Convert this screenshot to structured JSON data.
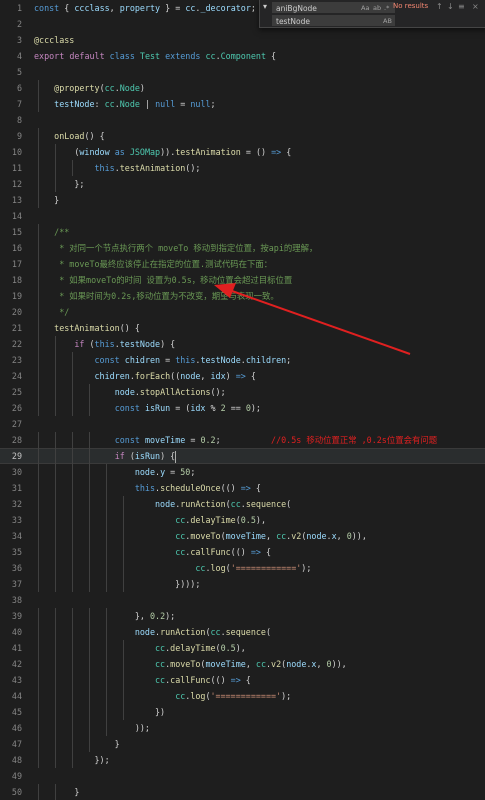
{
  "find": {
    "find_value": "aniBgNode",
    "replace_value": "testNode",
    "results_label": "No results",
    "match_case_label": "Aa",
    "whole_word_label": "ab",
    "regex_label": ".*",
    "preserve_case_label": "AB",
    "prev_icon": "arrow-up-icon",
    "next_icon": "arrow-down-icon",
    "toggle_icon": "chevron-down-icon"
  },
  "editor": {
    "active_line": 29,
    "annotation_text": "//0.5s 移动位置正常 ,0.2s位置会有问题",
    "arrow_color": "#e02020",
    "lines": [
      {
        "n": 1,
        "tokens": [
          [
            "kw",
            "const"
          ],
          [
            "pun",
            " { "
          ],
          [
            "var",
            "ccclass"
          ],
          [
            "pun",
            ", "
          ],
          [
            "var",
            "property"
          ],
          [
            "pun",
            " } = "
          ],
          [
            "var",
            "cc"
          ],
          [
            "pun",
            "."
          ],
          [
            "var",
            "_decorator"
          ],
          [
            "pun",
            ";"
          ]
        ]
      },
      {
        "n": 2,
        "tokens": []
      },
      {
        "n": 3,
        "tokens": [
          [
            "dec",
            "@ccclass"
          ]
        ]
      },
      {
        "n": 4,
        "tokens": [
          [
            "ctl",
            "export"
          ],
          [
            "pun",
            " "
          ],
          [
            "ctl",
            "default"
          ],
          [
            "pun",
            " "
          ],
          [
            "kw",
            "class"
          ],
          [
            "pun",
            " "
          ],
          [
            "cls",
            "Test"
          ],
          [
            "pun",
            " "
          ],
          [
            "kw",
            "extends"
          ],
          [
            "pun",
            " "
          ],
          [
            "cls",
            "cc"
          ],
          [
            "pun",
            "."
          ],
          [
            "cls",
            "Component"
          ],
          [
            "pun",
            " {"
          ]
        ]
      },
      {
        "n": 5,
        "tokens": []
      },
      {
        "n": 6,
        "tokens": [
          [
            "pun",
            "    "
          ],
          [
            "dec",
            "@property"
          ],
          [
            "pun",
            "("
          ],
          [
            "cls",
            "cc"
          ],
          [
            "pun",
            "."
          ],
          [
            "cls",
            "Node"
          ],
          [
            "pun",
            ")"
          ]
        ]
      },
      {
        "n": 7,
        "tokens": [
          [
            "pun",
            "    "
          ],
          [
            "var",
            "testNode"
          ],
          [
            "pun",
            ": "
          ],
          [
            "cls",
            "cc"
          ],
          [
            "pun",
            "."
          ],
          [
            "cls",
            "Node"
          ],
          [
            "pun",
            " | "
          ],
          [
            "kw",
            "null"
          ],
          [
            "pun",
            " = "
          ],
          [
            "kw",
            "null"
          ],
          [
            "pun",
            ";"
          ]
        ]
      },
      {
        "n": 8,
        "tokens": []
      },
      {
        "n": 9,
        "tokens": [
          [
            "pun",
            "    "
          ],
          [
            "fn",
            "onLoad"
          ],
          [
            "pun",
            "() {"
          ]
        ]
      },
      {
        "n": 10,
        "tokens": [
          [
            "pun",
            "        ("
          ],
          [
            "var",
            "window"
          ],
          [
            "pun",
            " "
          ],
          [
            "kw",
            "as"
          ],
          [
            "pun",
            " "
          ],
          [
            "cls",
            "JSOMap"
          ],
          [
            "pun",
            "))."
          ],
          [
            "fn",
            "testAnimation"
          ],
          [
            "pun",
            " = () "
          ],
          [
            "kw",
            "=>"
          ],
          [
            "pun",
            " {"
          ]
        ]
      },
      {
        "n": 11,
        "tokens": [
          [
            "pun",
            "            "
          ],
          [
            "kw",
            "this"
          ],
          [
            "pun",
            "."
          ],
          [
            "fn",
            "testAnimation"
          ],
          [
            "pun",
            "();"
          ]
        ]
      },
      {
        "n": 12,
        "tokens": [
          [
            "pun",
            "        };"
          ]
        ]
      },
      {
        "n": 13,
        "tokens": [
          [
            "pun",
            "    }"
          ]
        ]
      },
      {
        "n": 14,
        "tokens": []
      },
      {
        "n": 15,
        "tokens": [
          [
            "com",
            "    /**"
          ]
        ]
      },
      {
        "n": 16,
        "tokens": [
          [
            "com",
            "     * 对同一个节点执行两个 moveTo 移动到指定位置，按api的理解，"
          ]
        ]
      },
      {
        "n": 17,
        "tokens": [
          [
            "com",
            "     * moveTo最终应该停止在指定的位置.测试代码在下面："
          ]
        ]
      },
      {
        "n": 18,
        "tokens": [
          [
            "com",
            "     * 如果moveTo的时间 设置为0.5s，移动位置会超过目标位置"
          ]
        ]
      },
      {
        "n": 19,
        "tokens": [
          [
            "com",
            "     * 如果时间为0.2s,移动位置为不改变，期望与表现一致。"
          ]
        ]
      },
      {
        "n": 20,
        "tokens": [
          [
            "com",
            "     */"
          ]
        ]
      },
      {
        "n": 21,
        "tokens": [
          [
            "pun",
            "    "
          ],
          [
            "fn",
            "testAnimation"
          ],
          [
            "pun",
            "() {"
          ]
        ]
      },
      {
        "n": 22,
        "tokens": [
          [
            "pun",
            "        "
          ],
          [
            "ctl",
            "if"
          ],
          [
            "pun",
            " ("
          ],
          [
            "kw",
            "this"
          ],
          [
            "pun",
            "."
          ],
          [
            "var",
            "testNode"
          ],
          [
            "pun",
            ") {"
          ]
        ]
      },
      {
        "n": 23,
        "tokens": [
          [
            "pun",
            "            "
          ],
          [
            "kw",
            "const"
          ],
          [
            "pun",
            " "
          ],
          [
            "var",
            "chidren"
          ],
          [
            "pun",
            " = "
          ],
          [
            "kw",
            "this"
          ],
          [
            "pun",
            "."
          ],
          [
            "var",
            "testNode"
          ],
          [
            "pun",
            "."
          ],
          [
            "var",
            "children"
          ],
          [
            "pun",
            ";"
          ]
        ]
      },
      {
        "n": 24,
        "tokens": [
          [
            "pun",
            "            "
          ],
          [
            "var",
            "chidren"
          ],
          [
            "pun",
            "."
          ],
          [
            "fn",
            "forEach"
          ],
          [
            "pun",
            "(("
          ],
          [
            "var",
            "node"
          ],
          [
            "pun",
            ", "
          ],
          [
            "var",
            "idx"
          ],
          [
            "pun",
            ") "
          ],
          [
            "kw",
            "=>"
          ],
          [
            "pun",
            " {"
          ]
        ]
      },
      {
        "n": 25,
        "tokens": [
          [
            "pun",
            "                "
          ],
          [
            "var",
            "node"
          ],
          [
            "pun",
            "."
          ],
          [
            "fn",
            "stopAllActions"
          ],
          [
            "pun",
            "();"
          ]
        ]
      },
      {
        "n": 26,
        "tokens": [
          [
            "pun",
            "                "
          ],
          [
            "kw",
            "const"
          ],
          [
            "pun",
            " "
          ],
          [
            "var",
            "isRun"
          ],
          [
            "pun",
            " = ("
          ],
          [
            "var",
            "idx"
          ],
          [
            "pun",
            " % "
          ],
          [
            "num",
            "2"
          ],
          [
            "pun",
            " == "
          ],
          [
            "num",
            "0"
          ],
          [
            "pun",
            ");"
          ]
        ]
      },
      {
        "n": 27,
        "tokens": []
      },
      {
        "n": 28,
        "tokens": [
          [
            "pun",
            "                "
          ],
          [
            "kw",
            "const"
          ],
          [
            "pun",
            " "
          ],
          [
            "var",
            "moveTime"
          ],
          [
            "pun",
            " = "
          ],
          [
            "num",
            "0.2"
          ],
          [
            "pun",
            ";"
          ]
        ],
        "annotation": true
      },
      {
        "n": 29,
        "tokens": [
          [
            "pun",
            "                "
          ],
          [
            "ctl",
            "if"
          ],
          [
            "pun",
            " ("
          ],
          [
            "var",
            "isRun"
          ],
          [
            "pun",
            ") {"
          ]
        ],
        "caret": true
      },
      {
        "n": 30,
        "tokens": [
          [
            "pun",
            "                    "
          ],
          [
            "var",
            "node"
          ],
          [
            "pun",
            "."
          ],
          [
            "var",
            "y"
          ],
          [
            "pun",
            " = "
          ],
          [
            "num",
            "50"
          ],
          [
            "pun",
            ";"
          ]
        ]
      },
      {
        "n": 31,
        "tokens": [
          [
            "pun",
            "                    "
          ],
          [
            "kw",
            "this"
          ],
          [
            "pun",
            "."
          ],
          [
            "fn",
            "scheduleOnce"
          ],
          [
            "pun",
            "(() "
          ],
          [
            "kw",
            "=>"
          ],
          [
            "pun",
            " {"
          ]
        ]
      },
      {
        "n": 32,
        "tokens": [
          [
            "pun",
            "                        "
          ],
          [
            "var",
            "node"
          ],
          [
            "pun",
            "."
          ],
          [
            "fn",
            "runAction"
          ],
          [
            "pun",
            "("
          ],
          [
            "cls",
            "cc"
          ],
          [
            "pun",
            "."
          ],
          [
            "fn",
            "sequence"
          ],
          [
            "pun",
            "("
          ]
        ]
      },
      {
        "n": 33,
        "tokens": [
          [
            "pun",
            "                            "
          ],
          [
            "cls",
            "cc"
          ],
          [
            "pun",
            "."
          ],
          [
            "fn",
            "delayTime"
          ],
          [
            "pun",
            "("
          ],
          [
            "num",
            "0.5"
          ],
          [
            "pun",
            "),"
          ]
        ]
      },
      {
        "n": 34,
        "tokens": [
          [
            "pun",
            "                            "
          ],
          [
            "cls",
            "cc"
          ],
          [
            "pun",
            "."
          ],
          [
            "fn",
            "moveTo"
          ],
          [
            "pun",
            "("
          ],
          [
            "var",
            "moveTime"
          ],
          [
            "pun",
            ", "
          ],
          [
            "cls",
            "cc"
          ],
          [
            "pun",
            "."
          ],
          [
            "fn",
            "v2"
          ],
          [
            "pun",
            "("
          ],
          [
            "var",
            "node"
          ],
          [
            "pun",
            "."
          ],
          [
            "var",
            "x"
          ],
          [
            "pun",
            ", "
          ],
          [
            "num",
            "0"
          ],
          [
            "pun",
            ")),"
          ]
        ]
      },
      {
        "n": 35,
        "tokens": [
          [
            "pun",
            "                            "
          ],
          [
            "cls",
            "cc"
          ],
          [
            "pun",
            "."
          ],
          [
            "fn",
            "callFunc"
          ],
          [
            "pun",
            "(() "
          ],
          [
            "kw",
            "=>"
          ],
          [
            "pun",
            " {"
          ]
        ]
      },
      {
        "n": 36,
        "tokens": [
          [
            "pun",
            "                                "
          ],
          [
            "cls",
            "cc"
          ],
          [
            "pun",
            "."
          ],
          [
            "fn",
            "log"
          ],
          [
            "pun",
            "("
          ],
          [
            "str",
            "'============'"
          ],
          [
            "pun",
            ");"
          ]
        ]
      },
      {
        "n": 37,
        "tokens": [
          [
            "pun",
            "                            })));"
          ]
        ]
      },
      {
        "n": 38,
        "tokens": []
      },
      {
        "n": 39,
        "tokens": [
          [
            "pun",
            "                    }, "
          ],
          [
            "num",
            "0.2"
          ],
          [
            "pun",
            ");"
          ]
        ]
      },
      {
        "n": 40,
        "tokens": [
          [
            "pun",
            "                    "
          ],
          [
            "var",
            "node"
          ],
          [
            "pun",
            "."
          ],
          [
            "fn",
            "runAction"
          ],
          [
            "pun",
            "("
          ],
          [
            "cls",
            "cc"
          ],
          [
            "pun",
            "."
          ],
          [
            "fn",
            "sequence"
          ],
          [
            "pun",
            "("
          ]
        ]
      },
      {
        "n": 41,
        "tokens": [
          [
            "pun",
            "                        "
          ],
          [
            "cls",
            "cc"
          ],
          [
            "pun",
            "."
          ],
          [
            "fn",
            "delayTime"
          ],
          [
            "pun",
            "("
          ],
          [
            "num",
            "0.5"
          ],
          [
            "pun",
            "),"
          ]
        ]
      },
      {
        "n": 42,
        "tokens": [
          [
            "pun",
            "                        "
          ],
          [
            "cls",
            "cc"
          ],
          [
            "pun",
            "."
          ],
          [
            "fn",
            "moveTo"
          ],
          [
            "pun",
            "("
          ],
          [
            "var",
            "moveTime"
          ],
          [
            "pun",
            ", "
          ],
          [
            "cls",
            "cc"
          ],
          [
            "pun",
            "."
          ],
          [
            "fn",
            "v2"
          ],
          [
            "pun",
            "("
          ],
          [
            "var",
            "node"
          ],
          [
            "pun",
            "."
          ],
          [
            "var",
            "x"
          ],
          [
            "pun",
            ", "
          ],
          [
            "num",
            "0"
          ],
          [
            "pun",
            ")),"
          ]
        ]
      },
      {
        "n": 43,
        "tokens": [
          [
            "pun",
            "                        "
          ],
          [
            "cls",
            "cc"
          ],
          [
            "pun",
            "."
          ],
          [
            "fn",
            "callFunc"
          ],
          [
            "pun",
            "(() "
          ],
          [
            "kw",
            "=>"
          ],
          [
            "pun",
            " {"
          ]
        ]
      },
      {
        "n": 44,
        "tokens": [
          [
            "pun",
            "                            "
          ],
          [
            "cls",
            "cc"
          ],
          [
            "pun",
            "."
          ],
          [
            "fn",
            "log"
          ],
          [
            "pun",
            "("
          ],
          [
            "str",
            "'============'"
          ],
          [
            "pun",
            ");"
          ]
        ]
      },
      {
        "n": 45,
        "tokens": [
          [
            "pun",
            "                        })"
          ]
        ]
      },
      {
        "n": 46,
        "tokens": [
          [
            "pun",
            "                    ));"
          ]
        ]
      },
      {
        "n": 47,
        "tokens": [
          [
            "pun",
            "                }"
          ]
        ]
      },
      {
        "n": 48,
        "tokens": [
          [
            "pun",
            "            });"
          ]
        ]
      },
      {
        "n": 49,
        "tokens": []
      },
      {
        "n": 50,
        "tokens": [
          [
            "pun",
            "        }"
          ]
        ]
      }
    ]
  }
}
